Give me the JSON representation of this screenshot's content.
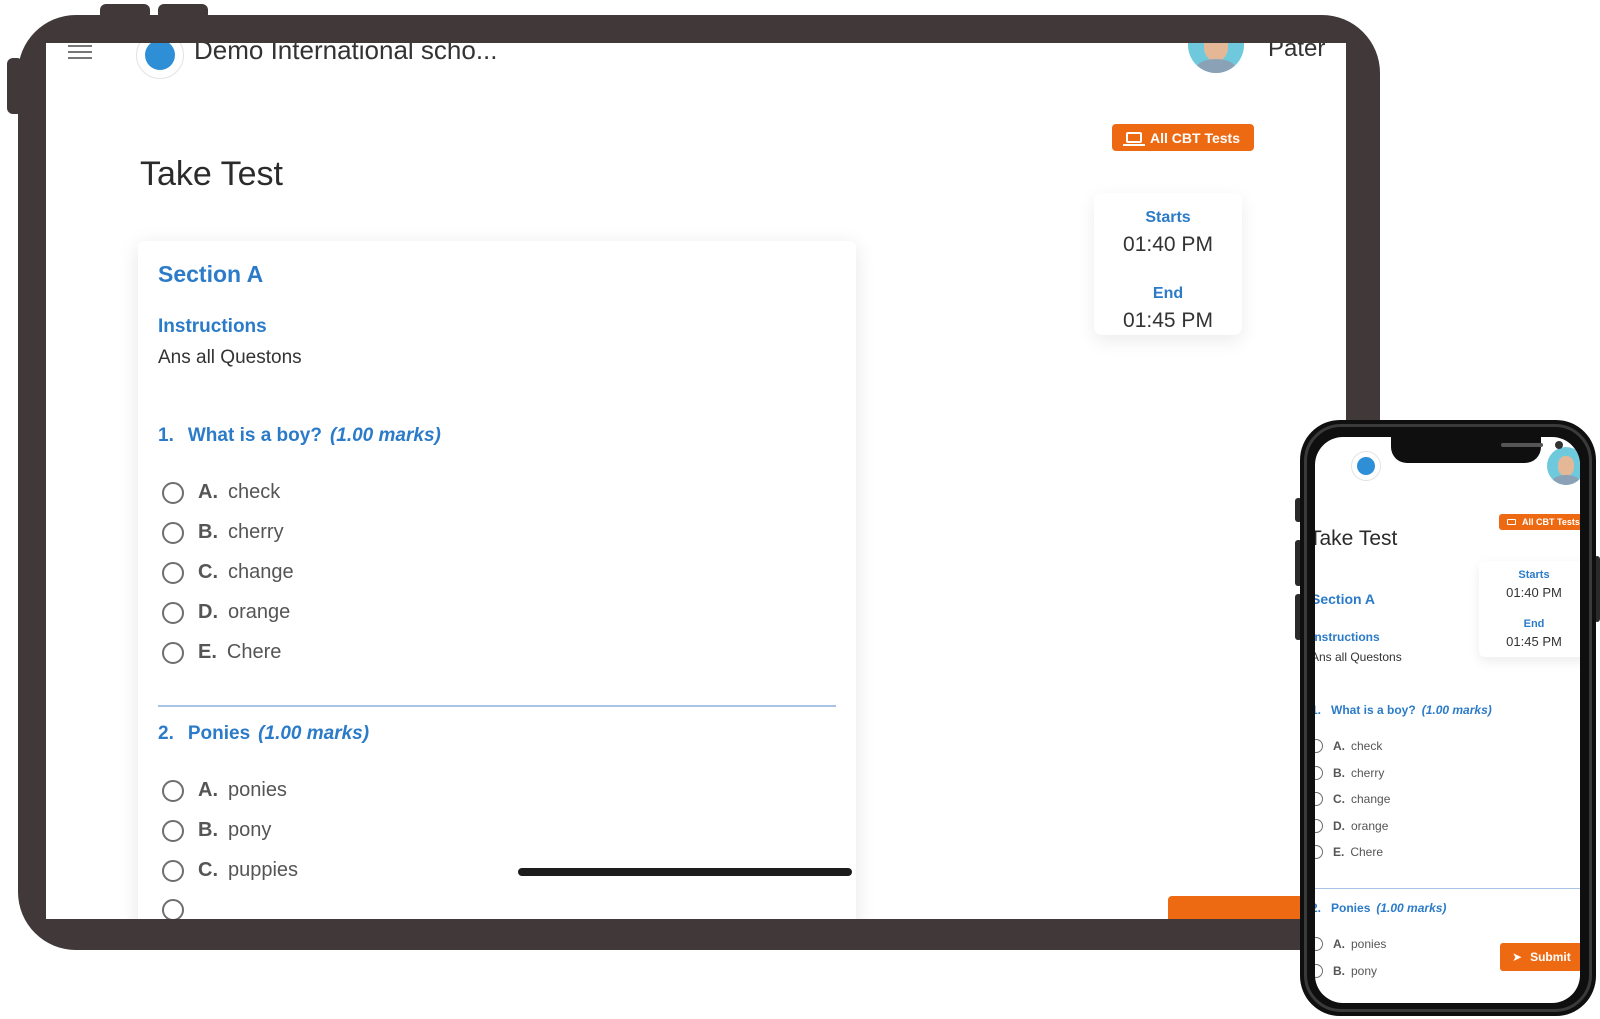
{
  "header": {
    "school_name": "Demo International scho...",
    "user_name": "Pater"
  },
  "actions": {
    "all_cbt_tests": "All CBT Tests",
    "submit": "Submit"
  },
  "page": {
    "title": "Take Test"
  },
  "schedule": {
    "starts_label": "Starts",
    "starts_value": "01:40 PM",
    "end_label": "End",
    "end_value": "01:45 PM"
  },
  "section": {
    "title": "Section A",
    "instructions_label": "Instructions",
    "instructions_text": "Ans all Questons"
  },
  "questions": [
    {
      "number": "1.",
      "text": "What is a boy?",
      "marks": "(1.00 marks)",
      "options": [
        {
          "letter": "A.",
          "text": "check"
        },
        {
          "letter": "B.",
          "text": "cherry"
        },
        {
          "letter": "C.",
          "text": "change"
        },
        {
          "letter": "D.",
          "text": "orange"
        },
        {
          "letter": "E.",
          "text": "Chere"
        }
      ]
    },
    {
      "number": "2.",
      "text": "Ponies",
      "marks": "(1.00 marks)",
      "options": [
        {
          "letter": "A.",
          "text": "ponies"
        },
        {
          "letter": "B.",
          "text": "pony"
        },
        {
          "letter": "C.",
          "text": "puppies"
        }
      ]
    }
  ],
  "colors": {
    "accent_blue": "#2b7bc9",
    "action_orange": "#ee6a12",
    "device_frame": "#413939",
    "divider": "#a9c3e6"
  },
  "icons": [
    "menu-icon",
    "school-logo-icon",
    "laptop-icon",
    "radio-unchecked-icon",
    "send-icon",
    "user-avatar"
  ]
}
